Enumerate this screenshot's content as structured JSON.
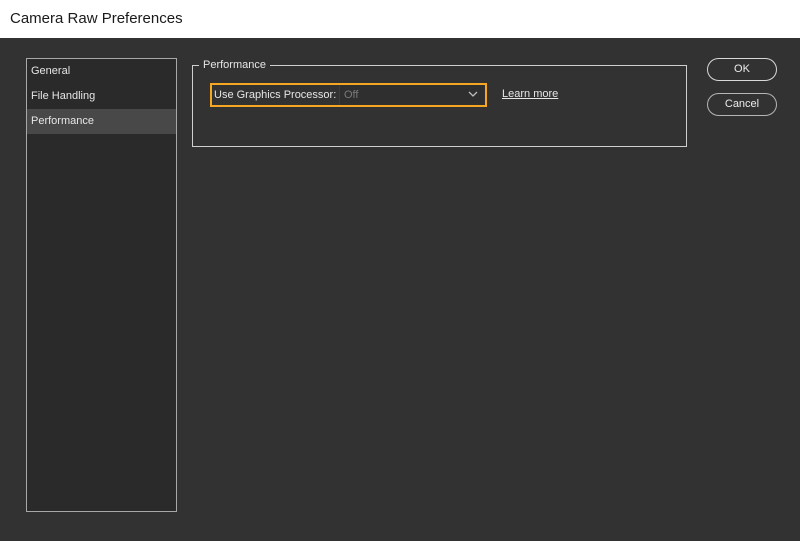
{
  "window": {
    "title": "Camera Raw Preferences"
  },
  "sidebar": {
    "items": [
      {
        "label": "General",
        "selected": false
      },
      {
        "label": "File Handling",
        "selected": false
      },
      {
        "label": "Performance",
        "selected": true
      }
    ]
  },
  "performance": {
    "group_title": "Performance",
    "graphics_processor": {
      "label": "Use Graphics Processor:",
      "selected_value": "Off"
    },
    "learn_more": "Learn more"
  },
  "buttons": {
    "ok": "OK",
    "cancel": "Cancel"
  },
  "colors": {
    "highlight": "#f5a623",
    "background": "#323232",
    "selected_item": "#484848"
  },
  "icons": {
    "dropdown": "chevron-down-icon"
  }
}
